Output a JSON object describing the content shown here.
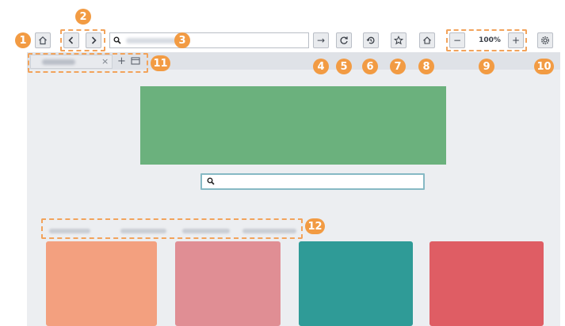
{
  "browser": {
    "toolbar": {
      "home_icon": "home-icon",
      "back_icon": "chevron-left-icon",
      "forward_icon": "chevron-right-icon",
      "go_arrow": "→",
      "refresh_icon": "refresh-icon",
      "history_icon": "history-icon",
      "bookmark_icon": "star-icon",
      "home2_icon": "home-outline-icon",
      "zoom_out": "−",
      "zoom_level": "100%",
      "zoom_in": "+",
      "settings_icon": "gear-icon"
    },
    "tabs": {
      "close": "×",
      "new_tab": "+",
      "tab_list_icon": "tab-list-icon"
    },
    "search_icon": "search-icon"
  },
  "callouts": [
    "1",
    "2",
    "3",
    "4",
    "5",
    "6",
    "7",
    "8",
    "9",
    "10",
    "11",
    "12"
  ],
  "colors": {
    "callout": "#f29b43",
    "banner": "#6bb17d",
    "tile_1": "#f3a07f",
    "tile_2": "#e08e94",
    "tile_3": "#2f9b97",
    "tile_4": "#df5d64"
  }
}
